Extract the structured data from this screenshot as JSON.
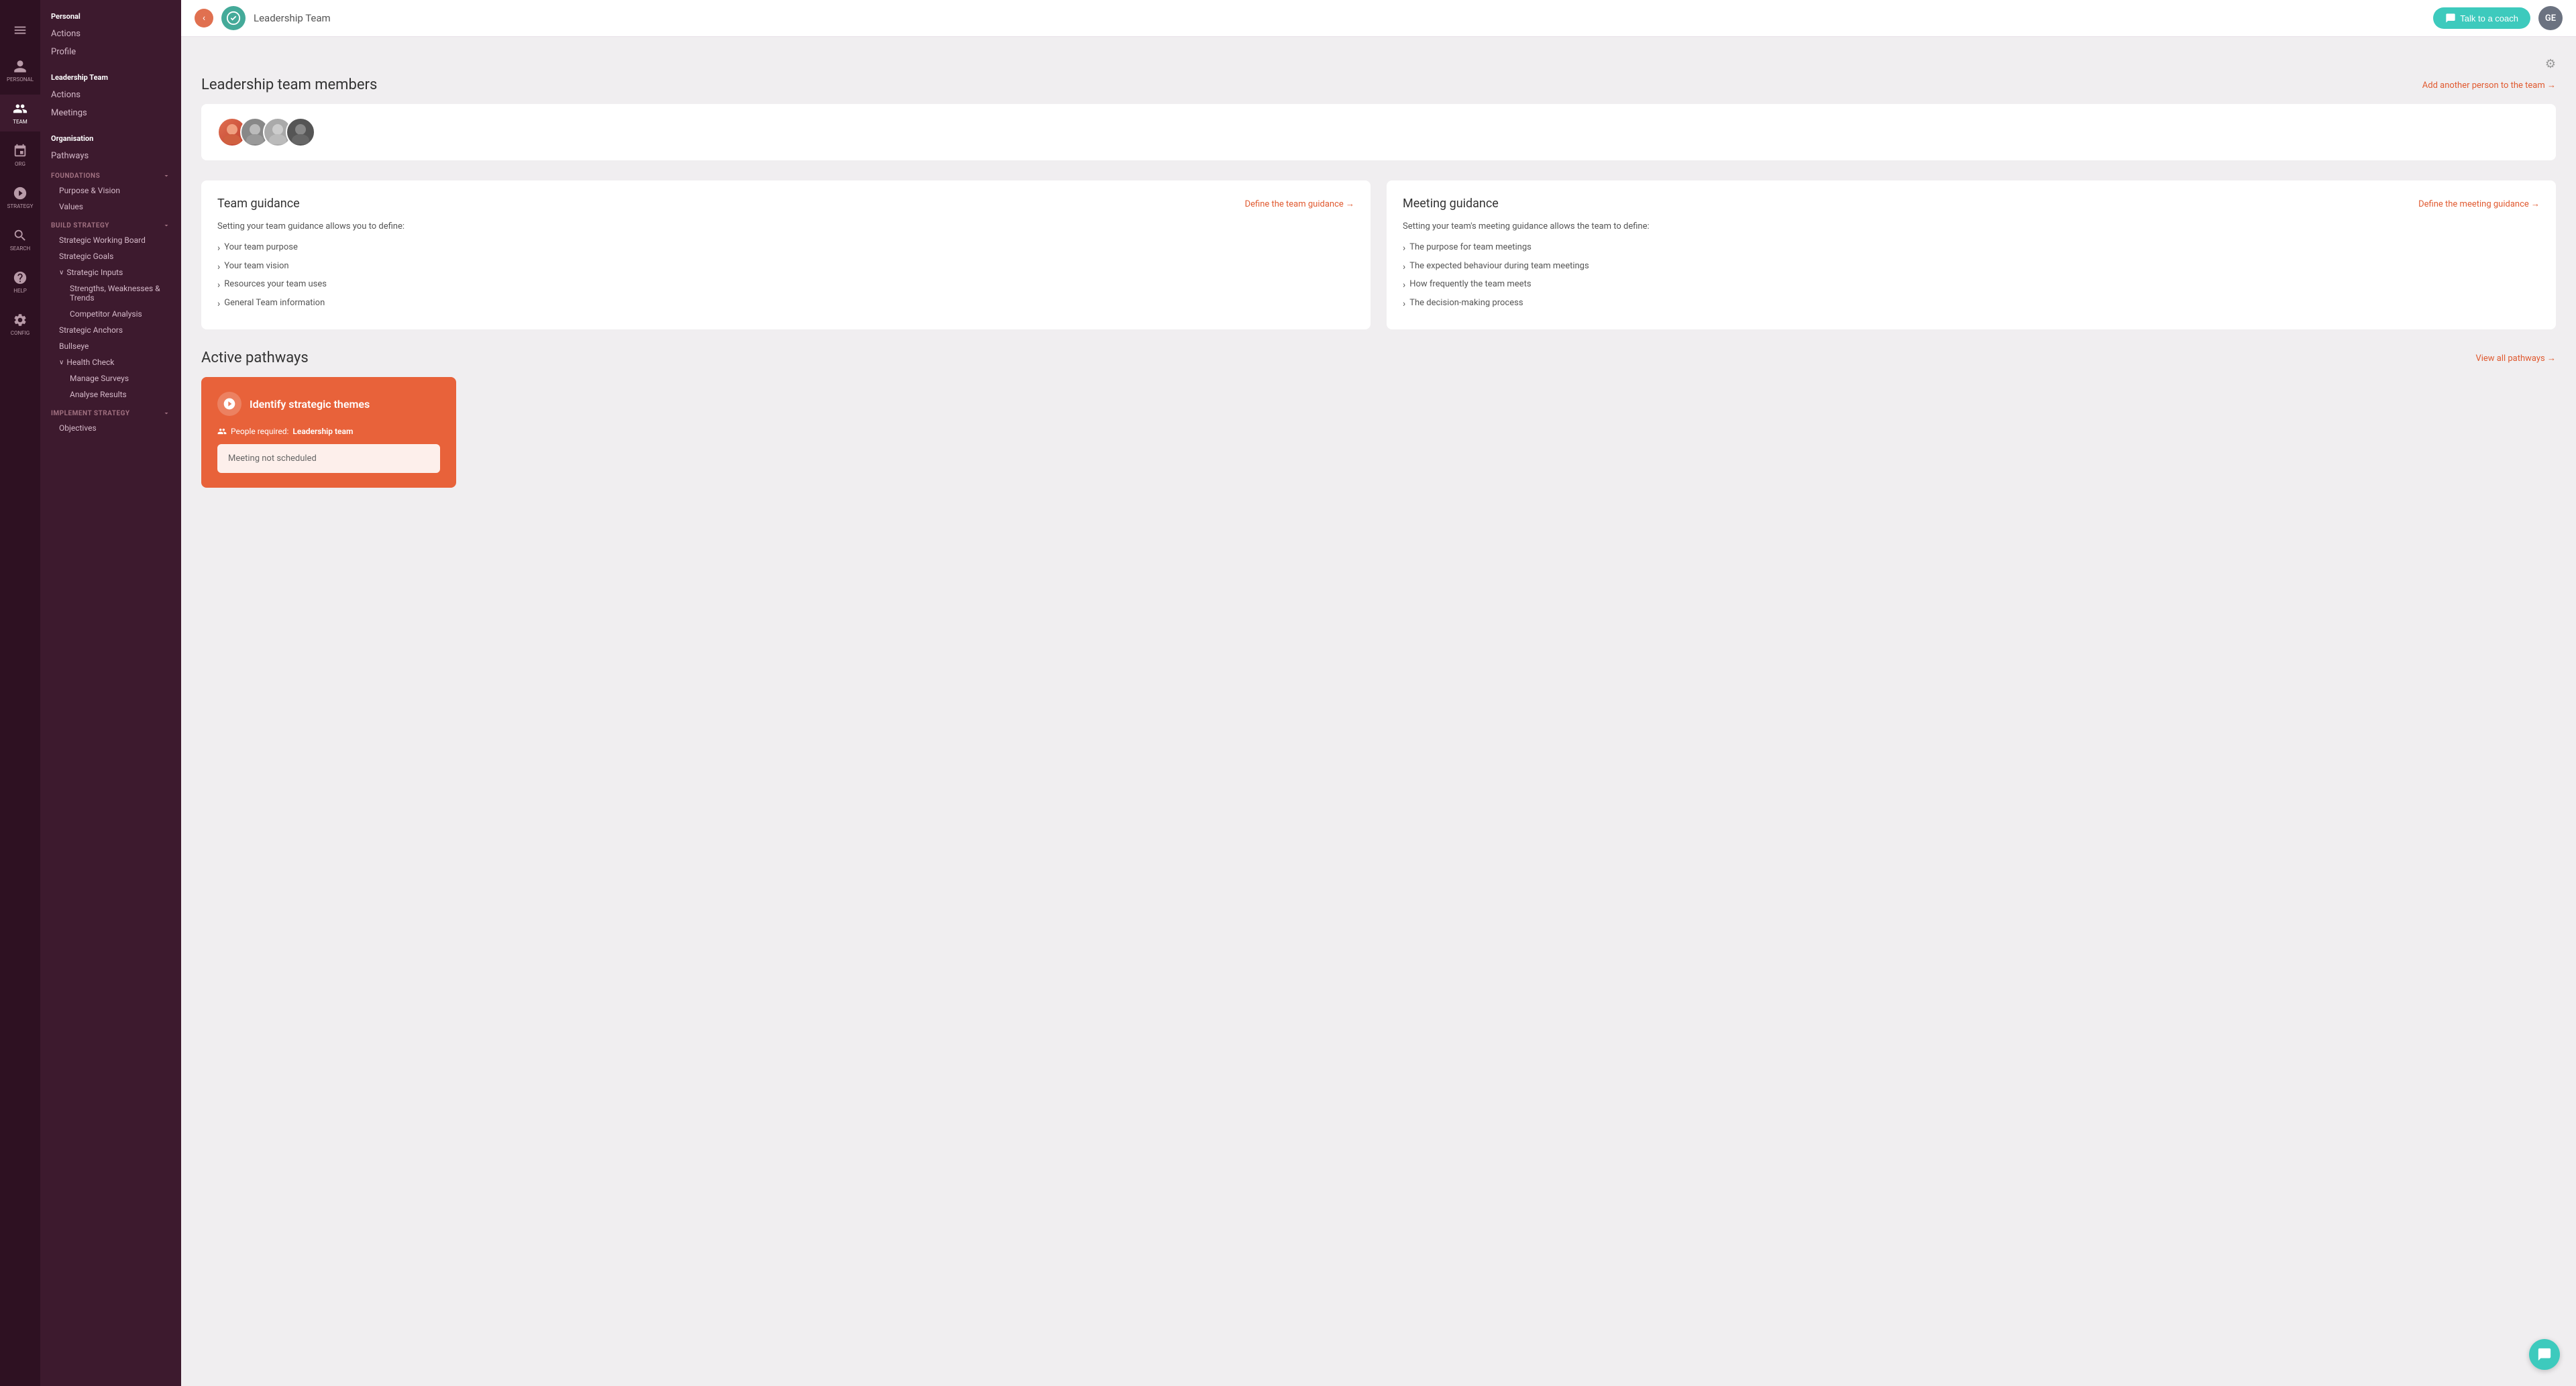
{
  "sidebar": {
    "hamburger_icon": "☰",
    "collapse_icon": "‹",
    "personal_section": "Personal",
    "personal_items": [
      {
        "label": "Actions",
        "id": "actions-personal"
      },
      {
        "label": "Profile",
        "id": "profile"
      }
    ],
    "leadership_section": "Leadership Team",
    "leadership_items": [
      {
        "label": "Actions",
        "id": "actions-leadership"
      },
      {
        "label": "Meetings",
        "id": "meetings"
      }
    ],
    "organisation_section": "Organisation",
    "org_items": [
      {
        "label": "Pathways",
        "id": "pathways"
      }
    ],
    "foundations_section": "FOUNDATIONS",
    "foundations_items": [
      {
        "label": "Purpose & Vision",
        "id": "purpose-vision"
      },
      {
        "label": "Values",
        "id": "values"
      }
    ],
    "build_strategy_section": "BUILD STRATEGY",
    "build_strategy_items": [
      {
        "label": "Strategic Working Board",
        "id": "strategic-working-board"
      },
      {
        "label": "Strategic Goals",
        "id": "strategic-goals"
      }
    ],
    "strategic_inputs_label": "Strategic Inputs",
    "strategic_inputs_sub": [
      {
        "label": "Strengths, Weaknesses & Trends",
        "id": "strengths"
      },
      {
        "label": "Competitor Analysis",
        "id": "competitor-analysis"
      }
    ],
    "strategic_anchors_label": "Strategic Anchors",
    "bullseye_label": "Bullseye",
    "health_check_label": "Health Check",
    "health_check_sub": [
      {
        "label": "Manage Surveys",
        "id": "manage-surveys"
      },
      {
        "label": "Analyse Results",
        "id": "analyse-results"
      }
    ],
    "implement_strategy_section": "IMPLEMENT STRATEGY",
    "implement_items": [
      {
        "label": "Objectives",
        "id": "objectives"
      }
    ],
    "nav_icons": [
      {
        "label": "PERSONAL",
        "id": "nav-personal"
      },
      {
        "label": "TEAM",
        "id": "nav-team",
        "active": true
      },
      {
        "label": "ORG",
        "id": "nav-org"
      },
      {
        "label": "STRATEGY",
        "id": "nav-strategy"
      },
      {
        "label": "SEARCH",
        "id": "nav-search"
      },
      {
        "label": "HELP",
        "id": "nav-help"
      },
      {
        "label": "CONFIG",
        "id": "nav-config"
      }
    ]
  },
  "topbar": {
    "logo_alt": "logo",
    "team_name": "Leadership Team",
    "talk_to_coach": "Talk to a coach",
    "user_initials": "GE",
    "settings_icon": "⚙"
  },
  "members": {
    "title": "Leadership team members",
    "add_link": "Add another person to the team →",
    "avatars": [
      {
        "color": "#e07050",
        "initials": ""
      },
      {
        "color": "#888",
        "initials": ""
      },
      {
        "color": "#aaa",
        "initials": ""
      },
      {
        "color": "#555",
        "initials": ""
      }
    ]
  },
  "team_guidance": {
    "title": "Team guidance",
    "define_link": "Define the team guidance →",
    "intro": "Setting your team guidance allows you to define:",
    "items": [
      "Your team purpose",
      "Your team vision",
      "Resources your team uses",
      "General Team information"
    ]
  },
  "meeting_guidance": {
    "title": "Meeting guidance",
    "define_link": "Define the meeting guidance →",
    "intro": "Setting your team's meeting guidance allows the team to define:",
    "items": [
      "The purpose for team meetings",
      "The expected behaviour during team meetings",
      "How frequently the team meets",
      "The decision-making process"
    ]
  },
  "active_pathways": {
    "title": "Active pathways",
    "view_all_link": "View all pathways →",
    "pathway": {
      "title": "Identify strategic themes",
      "people_required_label": "People required:",
      "people_required_value": "Leadership team",
      "meeting_status": "Meeting not scheduled"
    }
  },
  "colors": {
    "accent": "#e05a30",
    "sidebar_bg": "#3d1a2e",
    "sidebar_dark": "#2e1122",
    "teal": "#3dcabd"
  }
}
